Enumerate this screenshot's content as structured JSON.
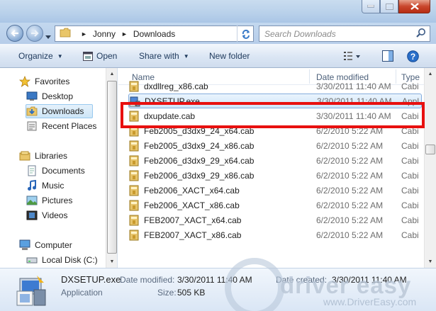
{
  "breadcrumb": [
    "Jonny",
    "Downloads"
  ],
  "search": {
    "placeholder": "Search Downloads"
  },
  "toolbar": {
    "organize": "Organize",
    "open": "Open",
    "share_with": "Share with",
    "new_folder": "New folder"
  },
  "nav": {
    "favorites": "Favorites",
    "desktop": "Desktop",
    "downloads": "Downloads",
    "recent_places": "Recent Places",
    "libraries": "Libraries",
    "documents": "Documents",
    "music": "Music",
    "pictures": "Pictures",
    "videos": "Videos",
    "computer": "Computer",
    "local_disk": "Local Disk (C:)"
  },
  "columns": {
    "name": "Name",
    "date": "Date modified",
    "type": "Type"
  },
  "files": [
    {
      "name": "dxdllreg_x86.cab",
      "date": "3/30/2011 11:40 AM",
      "type": "Cabi",
      "icon": "cab-icon"
    },
    {
      "name": "DXSETUP.exe",
      "date": "3/30/2011 11:40 AM",
      "type": "Appl",
      "icon": "setup-exe-icon",
      "selected": true
    },
    {
      "name": "dxupdate.cab",
      "date": "3/30/2011 11:40 AM",
      "type": "Cabi",
      "icon": "cab-icon"
    },
    {
      "name": "Feb2005_d3dx9_24_x64.cab",
      "date": "6/2/2010 5:22 AM",
      "type": "Cabi",
      "icon": "cab-icon"
    },
    {
      "name": "Feb2005_d3dx9_24_x86.cab",
      "date": "6/2/2010 5:22 AM",
      "type": "Cabi",
      "icon": "cab-icon"
    },
    {
      "name": "Feb2006_d3dx9_29_x64.cab",
      "date": "6/2/2010 5:22 AM",
      "type": "Cabi",
      "icon": "cab-icon"
    },
    {
      "name": "Feb2006_d3dx9_29_x86.cab",
      "date": "6/2/2010 5:22 AM",
      "type": "Cabi",
      "icon": "cab-icon"
    },
    {
      "name": "Feb2006_XACT_x64.cab",
      "date": "6/2/2010 5:22 AM",
      "type": "Cabi",
      "icon": "cab-icon"
    },
    {
      "name": "Feb2006_XACT_x86.cab",
      "date": "6/2/2010 5:22 AM",
      "type": "Cabi",
      "icon": "cab-icon"
    },
    {
      "name": "FEB2007_XACT_x64.cab",
      "date": "6/2/2010 5:22 AM",
      "type": "Cabi",
      "icon": "cab-icon"
    },
    {
      "name": "FEB2007_XACT_x86.cab",
      "date": "6/2/2010 5:22 AM",
      "type": "Cabi",
      "icon": "cab-icon"
    }
  ],
  "details": {
    "filename": "DXSETUP.exe",
    "filetype": "Application",
    "date_modified_label": "Date modified:",
    "date_modified": "3/30/2011 11:40 AM",
    "size_label": "Size:",
    "size": "505 KB",
    "date_created_label": "Date created:",
    "date_created": "3/30/2011 11:40 AM"
  },
  "watermark": {
    "brand": "driver easy",
    "url": "www.DriverEasy.com"
  },
  "colors": {
    "highlight": "#e8100f",
    "accent": "#1e395b"
  }
}
